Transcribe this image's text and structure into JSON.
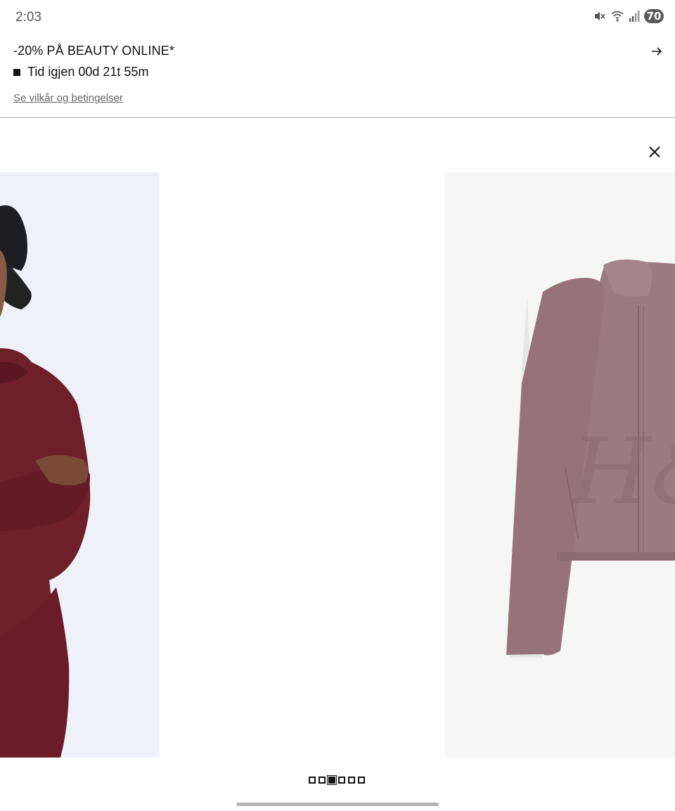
{
  "status_bar": {
    "time": "2:03",
    "battery": "70",
    "icons": [
      "mute-icon",
      "wifi-icon",
      "signal-icon",
      "battery-icon"
    ]
  },
  "promo": {
    "title": "-20% PÅ BEAUTY ONLINE*",
    "timer": "Tid igjen 00d 21t 55m",
    "terms_link": "Se vilkår og betingelser",
    "arrow_icon": "arrow-right-icon"
  },
  "gallery": {
    "close_icon": "close-icon",
    "slides": [
      {
        "name": "model-photo",
        "color": "#6e1f2a"
      },
      {
        "name": "blank-slide"
      },
      {
        "name": "product-photo",
        "color": "#9c7a82"
      }
    ],
    "pagination": {
      "total": 6,
      "active_index": 2
    }
  },
  "colors": {
    "accent": "#111111",
    "link": "#666666",
    "divider": "#cfcfcf",
    "model_garment": "#6e1f2a",
    "product_garment": "#9c7a82"
  }
}
